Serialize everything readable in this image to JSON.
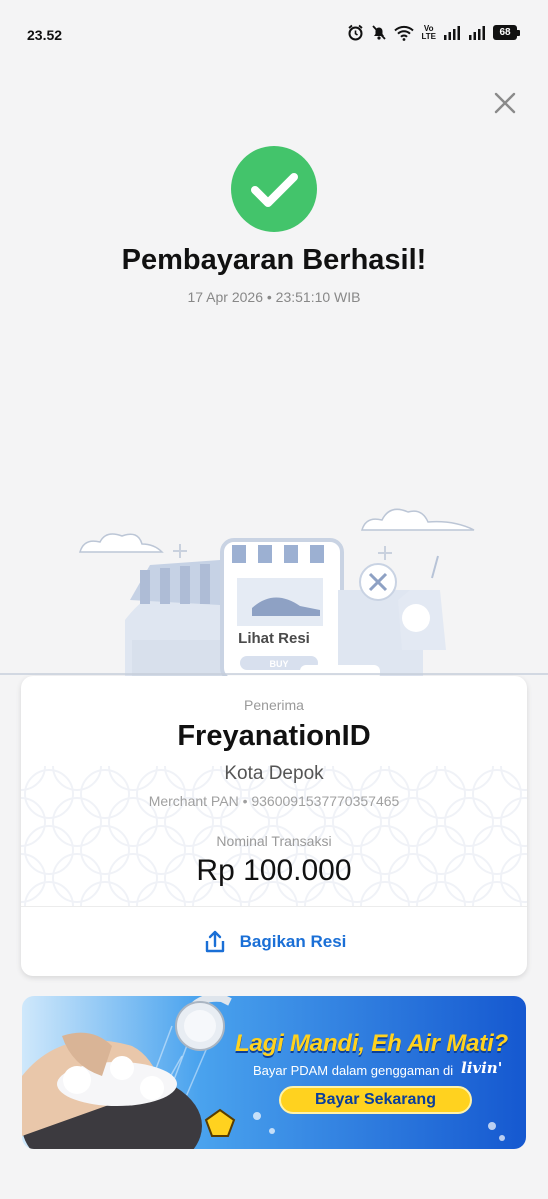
{
  "status_bar": {
    "time": "23.52",
    "network_label_top": "Vo",
    "network_label_bottom": "LTE",
    "battery": "68",
    "icons": [
      "alarm-icon",
      "mute-icon",
      "wifi-icon",
      "volte-icon",
      "signal-icon",
      "signal-icon",
      "battery-icon"
    ]
  },
  "header": {
    "close_icon": "close-icon"
  },
  "result": {
    "icon": "check-circle-icon",
    "title": "Pembayaran Berhasil!",
    "timestamp": "17 Apr 2026 • 23:51:10 WIB",
    "success_color": "#43c46b"
  },
  "illustration": {
    "overlay_label": "Lihat Resi",
    "buy_label": "BUY"
  },
  "receipt": {
    "recipient_label": "Penerima",
    "recipient_name": "FreyanationID",
    "recipient_city": "Kota Depok",
    "merchant_pan": "Merchant PAN • 9360091537770357465",
    "amount_label": "Nominal Transaksi",
    "amount": "Rp 100.000",
    "share_label": "Bagikan Resi",
    "share_icon": "share-icon",
    "accent_color": "#1a6fd6"
  },
  "promo_banner": {
    "headline": "Lagi Mandi, Eh Air Mati?",
    "subtext": "Bayar PDAM dalam genggaman di",
    "brand": "livin'",
    "cta": "Bayar Sekarang",
    "background_color": "#1664d8",
    "highlight_color": "#ffd21f"
  }
}
